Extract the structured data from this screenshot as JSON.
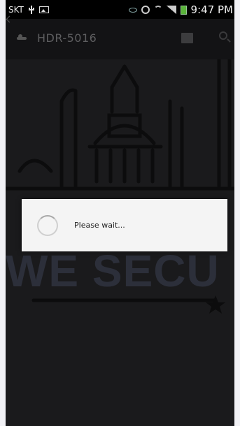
{
  "status_bar": {
    "carrier": "SKT",
    "time": "9:47 PM",
    "icons": [
      "usb-icon",
      "image-icon",
      "eye-icon",
      "alarm-icon",
      "wifi-icon",
      "signal-icon",
      "battery-icon"
    ]
  },
  "action_bar": {
    "title": "HDR-5016",
    "icons": [
      "back-icon",
      "app-icon",
      "stop-icon",
      "search-icon"
    ]
  },
  "background": {
    "banner_text": "WE SECU"
  },
  "dialog": {
    "message": "Please wait..."
  },
  "colors": {
    "screen_bg": "#1a1a1c",
    "dialog_bg": "#f4f4f4",
    "battery": "#5ab43a"
  }
}
